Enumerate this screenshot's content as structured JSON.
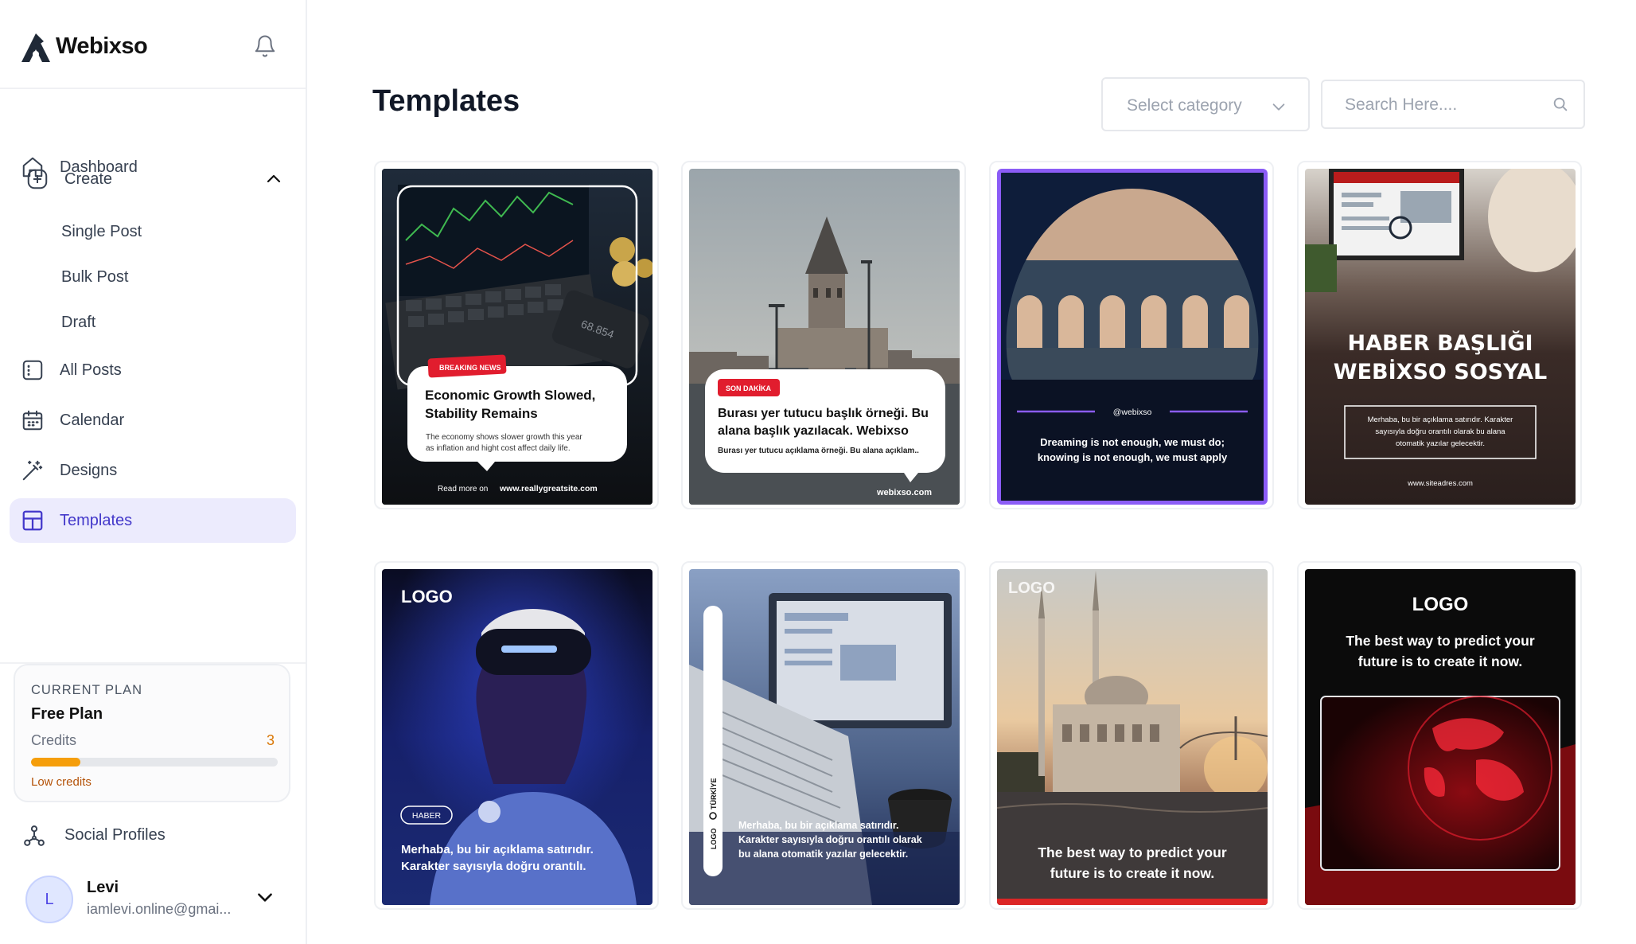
{
  "brand": {
    "name": "Webixso"
  },
  "nav": {
    "dashboard": "Dashboard",
    "create": "Create",
    "create_sub": [
      "Single Post",
      "Bulk Post",
      "Draft"
    ],
    "all_posts": "All Posts",
    "calendar": "Calendar",
    "designs": "Designs",
    "templates": "Templates",
    "social_profiles": "Social Profiles"
  },
  "plan": {
    "kicker": "CURRENT PLAN",
    "name": "Free Plan",
    "credits_label": "Credits",
    "credits_value": "3",
    "credits_fraction": 0.2,
    "warning": "Low credits"
  },
  "user": {
    "initial": "L",
    "name": "Levi",
    "email": "iamlevi.online@gmai..."
  },
  "main": {
    "title": "Templates",
    "category_placeholder": "Select category",
    "search_placeholder": "Search Here...."
  },
  "templates": [
    {
      "badge": "BREAKING NEWS",
      "headline_1": "Economic Growth Slowed,",
      "headline_2": "Stability Remains",
      "body_1": "The economy shows slower growth  this year",
      "body_2": "as inflation and hight cost affect daily life.",
      "footer_prefix": "Read more on",
      "footer_site": "www.reallygreatsite.com",
      "screen_value": "68.854"
    },
    {
      "badge": "SON DAKİKA",
      "headline_1": "Burası yer tutucu başlık örneği. Bu",
      "headline_2": "alana başlık yazılacak. Webixso",
      "body": "Burası yer tutucu açıklama örneği. Bu alana açıklam..",
      "site": "webixso.com"
    },
    {
      "handle": "@webixso",
      "quote_1": "Dreaming is not enough, we must do;",
      "quote_2": "knowing is not enough, we must apply"
    },
    {
      "title_1": "HABER BAŞLIĞI",
      "title_2": "WEBİXSO SOSYAL",
      "body_1": "Merhaba, bu bir açıklama satırıdır. Karakter",
      "body_2": "sayısıyla doğru orantılı olarak bu alana",
      "body_3": "otomatik yazılar gelecektir.",
      "site": "www.siteadres.com"
    },
    {
      "logo": "LOGO",
      "tag": "HABER",
      "text_1": "Merhaba, bu bir açıklama satırıdır.",
      "text_2": "Karakter sayısıyla doğru orantılı."
    },
    {
      "side_1": "TÜRKİYE",
      "side_2": "LOGO",
      "text_1": "Merhaba, bu bir açıklama satırıdır.",
      "text_2": "Karakter sayısıyla doğru orantılı olarak",
      "text_3": "bu alana otomatik yazılar gelecektir."
    },
    {
      "logo": "LOGO",
      "text_1": "The best way to predict your",
      "text_2": "future is to create it now."
    },
    {
      "logo": "LOGO",
      "text_1": "The best way to predict your",
      "text_2": "future is to create it now."
    }
  ],
  "colors": {
    "accent": "#4338ca",
    "active_bg": "#ecebfd",
    "warning": "#d97706",
    "selected_border": "#8b5cf6"
  },
  "icons": {
    "brand": "logo-mark-icon",
    "notifications": "bell-icon",
    "dashboard": "home-icon",
    "create": "plus-circle-icon",
    "all_posts": "list-icon",
    "calendar": "calendar-icon",
    "designs": "magic-wand-icon",
    "templates": "layout-icon",
    "social": "network-icon"
  }
}
